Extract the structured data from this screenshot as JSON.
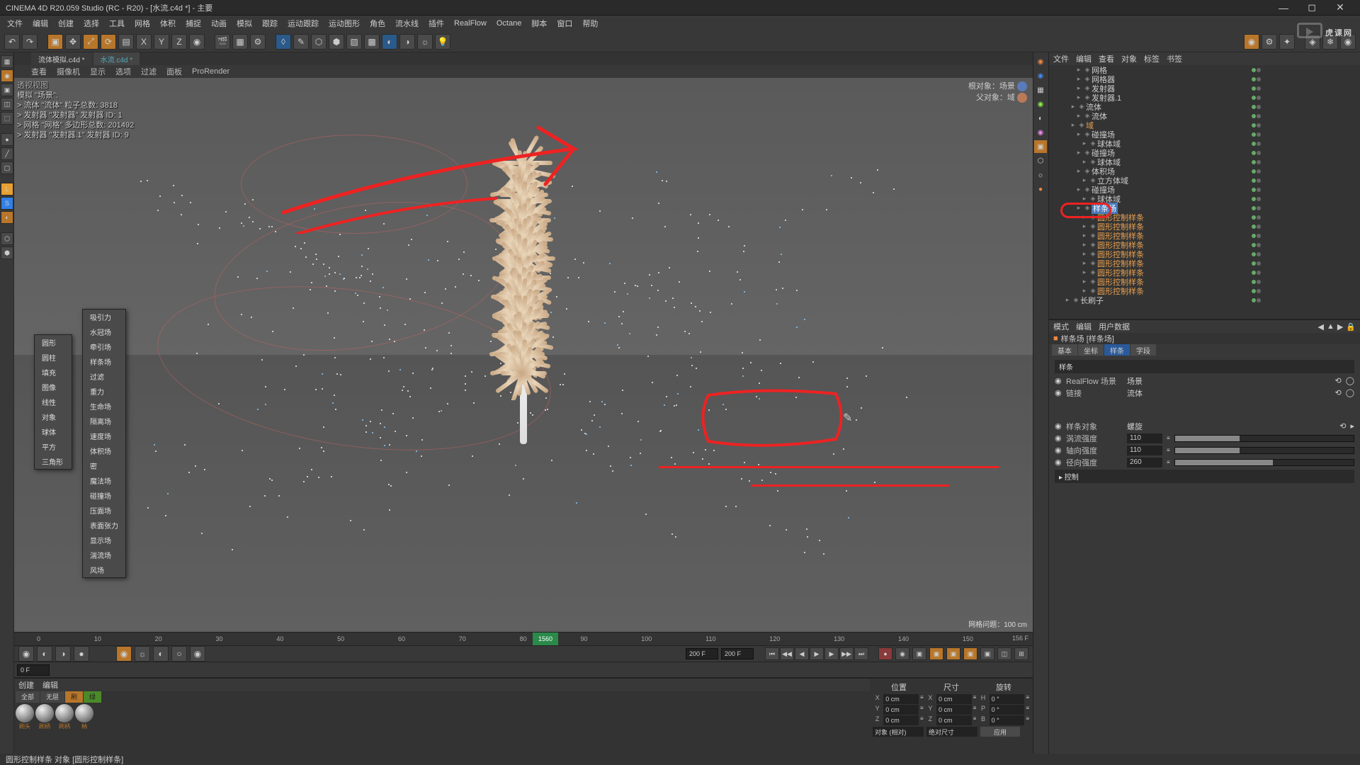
{
  "title": "CINEMA 4D R20.059 Studio (RC - R20) - [水流.c4d *] - 主要",
  "menus": [
    "文件",
    "编辑",
    "创建",
    "选择",
    "工具",
    "网格",
    "体积",
    "捕捉",
    "动画",
    "模拟",
    "跟踪",
    "运动跟踪",
    "运动图形",
    "角色",
    "流水线",
    "插件",
    "RealFlow",
    "Octane",
    "脚本",
    "窗口",
    "帮助"
  ],
  "tabs": {
    "inactive": "流体模拟.c4d *",
    "active": "水流.c4d *"
  },
  "vp_menu": [
    "查看",
    "摄像机",
    "显示",
    "选项",
    "过滤",
    "面板",
    "ProRender"
  ],
  "vp_info_title": "透视视图",
  "vp_info_lines": [
    "模拟 \"场景\":",
    "  > 流体 \"流体\" 粒子总数: 3818",
    "  > 发射器 \"发射器\" 发射器 ID: 1",
    "  > 网格 \"网格\" 多边形总数: 201492",
    "  > 发射器 \"发射器.1\" 发射器 ID: 9"
  ],
  "vp_tr": {
    "l1": "根对象：场景",
    "l2": "父对象：域"
  },
  "vp_br": "网格问题：100 cm",
  "menu1": [
    "圆形",
    "圆柱",
    "填充",
    "图像",
    "线性",
    "对象",
    "球体",
    "平方",
    "三角形"
  ],
  "menu2": [
    "吸引力",
    "水冠场",
    "牵引场",
    "样条场",
    "过滤",
    "重力",
    "生命场",
    "隔离场",
    "速度场",
    "体积场",
    "密",
    "魔法场",
    "碰撞场",
    "压面场",
    "表面张力",
    "显示场",
    "湍流场",
    "风场"
  ],
  "timeline": {
    "ticks": [
      "0",
      "10",
      "20",
      "30",
      "40",
      "50",
      "60",
      "70",
      "80",
      "90",
      "100",
      "110",
      "120",
      "130",
      "140",
      "150"
    ],
    "marker": "1560",
    "end": "156 F"
  },
  "frames": {
    "a": "0 F",
    "b": "200 F",
    "c": "200 F"
  },
  "mat_menu": [
    "创建",
    "编辑"
  ],
  "mat_tabs": [
    "全部",
    "无层",
    "刷",
    "绿"
  ],
  "mat_labels": [
    "刷头",
    "刷柄",
    "刷柄",
    "枘"
  ],
  "coord": {
    "hdr": [
      "位置",
      "尺寸",
      "旋转"
    ],
    "rows": [
      {
        "a": "X",
        "v1": "0 cm",
        "b": "X",
        "v2": "0 cm",
        "c": "H",
        "v3": "0 °"
      },
      {
        "a": "Y",
        "v1": "0 cm",
        "b": "Y",
        "v2": "0 cm",
        "c": "P",
        "v3": "0 °"
      },
      {
        "a": "Z",
        "v1": "0 cm",
        "b": "Z",
        "v2": "0 cm",
        "c": "B",
        "v3": "0 °"
      }
    ],
    "sel1": "对象 (相对)",
    "sel2": "绝对尺寸",
    "btn": "应用"
  },
  "obj_menu": [
    "文件",
    "编辑",
    "查看",
    "对象",
    "标签",
    "书签"
  ],
  "tree": [
    {
      "ind": 32,
      "txt": "网格",
      "cls": ""
    },
    {
      "ind": 32,
      "txt": "网格器",
      "cls": ""
    },
    {
      "ind": 32,
      "txt": "发射器",
      "cls": ""
    },
    {
      "ind": 32,
      "txt": "发射器.1",
      "cls": ""
    },
    {
      "ind": 24,
      "txt": "流体",
      "cls": ""
    },
    {
      "ind": 32,
      "txt": "流体",
      "cls": ""
    },
    {
      "ind": 24,
      "txt": "域",
      "cls": "orange"
    },
    {
      "ind": 32,
      "txt": "碰撞场",
      "cls": ""
    },
    {
      "ind": 40,
      "txt": "球体域",
      "cls": ""
    },
    {
      "ind": 32,
      "txt": "碰撞场",
      "cls": ""
    },
    {
      "ind": 40,
      "txt": "球体域",
      "cls": ""
    },
    {
      "ind": 32,
      "txt": "体积场",
      "cls": ""
    },
    {
      "ind": 40,
      "txt": "立方体域",
      "cls": ""
    },
    {
      "ind": 32,
      "txt": "碰撞场",
      "cls": ""
    },
    {
      "ind": 40,
      "txt": "球体域",
      "cls": ""
    },
    {
      "ind": 32,
      "txt": "样条场",
      "cls": "hl"
    },
    {
      "ind": 40,
      "txt": "圆形控制样条",
      "cls": "orange"
    },
    {
      "ind": 40,
      "txt": "圆形控制样条",
      "cls": "orange"
    },
    {
      "ind": 40,
      "txt": "圆形控制样条",
      "cls": "orange"
    },
    {
      "ind": 40,
      "txt": "圆形控制样条",
      "cls": "orange"
    },
    {
      "ind": 40,
      "txt": "圆形控制样条",
      "cls": "orange"
    },
    {
      "ind": 40,
      "txt": "圆形控制样条",
      "cls": "orange"
    },
    {
      "ind": 40,
      "txt": "圆形控制样条",
      "cls": "orange"
    },
    {
      "ind": 40,
      "txt": "圆形控制样条",
      "cls": "orange"
    },
    {
      "ind": 40,
      "txt": "圆形控制样条",
      "cls": "orange"
    },
    {
      "ind": 16,
      "txt": "长刷子",
      "cls": ""
    }
  ],
  "attr_menu": [
    "模式",
    "编辑",
    "用户数据"
  ],
  "attr_title": "样条场 [样条场]",
  "attr_tabs": [
    "基本",
    "坐标",
    "样条",
    "字段"
  ],
  "attr_section": "样条",
  "attr_rows1": [
    {
      "lbl": "RealFlow 场景",
      "val": "场景"
    },
    {
      "lbl": "链接",
      "val": "流体"
    }
  ],
  "attr_rows2": [
    {
      "lbl": "样条对象",
      "val": "螺旋"
    },
    {
      "lbl": "涡流强度",
      "val": "110",
      "pct": 36
    },
    {
      "lbl": "轴向强度",
      "val": "110",
      "pct": 36
    },
    {
      "lbl": "径向强度",
      "val": "260",
      "pct": 55
    }
  ],
  "attr_ctrl": "▸ 控制",
  "status": "圆形控制样条 对象  [圆形控制样条]",
  "watermark": "虎课网",
  "chart_data": {
    "type": "table",
    "note": "no chart present"
  }
}
